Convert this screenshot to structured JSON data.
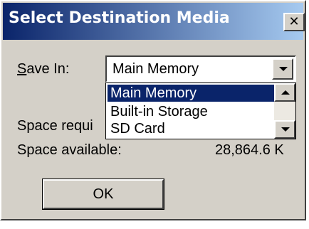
{
  "window": {
    "title": "Select Destination Media",
    "close_glyph": "✕"
  },
  "form": {
    "save_in_label": "Save In:",
    "save_in_value": "Main Memory",
    "options": [
      "Main Memory",
      "Built-in Storage",
      "SD Card"
    ],
    "space_required_label": "Space requi",
    "space_available_label": "Space available:",
    "space_available_value": "28,864.6 K"
  },
  "buttons": {
    "ok_label": "OK"
  },
  "colors": {
    "titlebar_start": "#0a246a",
    "titlebar_end": "#a6caf0",
    "face": "#d4d0c8",
    "selection": "#0a246a"
  }
}
